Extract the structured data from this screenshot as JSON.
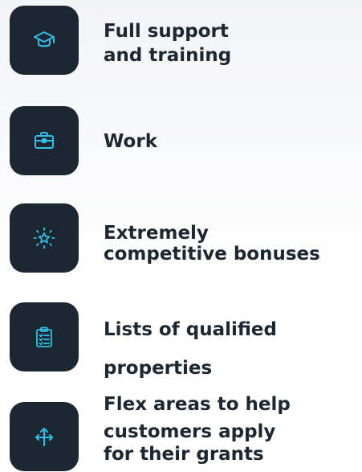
{
  "features": [
    {
      "icon": "graduation-cap-icon",
      "lines": [
        "Full  support",
        "and training"
      ]
    },
    {
      "icon": "briefcase-icon",
      "lines": [
        "Work"
      ]
    },
    {
      "icon": "sparkle-star-icon",
      "lines": [
        "Extremely",
        "competitive bonuses"
      ]
    },
    {
      "icon": "clipboard-checklist-icon",
      "lines": [
        "Lists of qualified",
        "properties"
      ]
    },
    {
      "icon": "split-arrows-icon",
      "lines": [
        "Flex areas to help",
        "customers apply",
        "for their grants"
      ]
    }
  ],
  "colors": {
    "tile_background": "#1d2731",
    "icon_accent": "#2fc1e6",
    "text": "#1d2731"
  }
}
